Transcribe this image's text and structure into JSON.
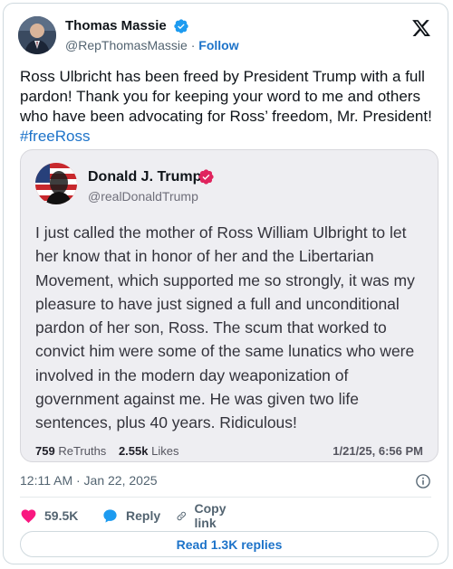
{
  "author": {
    "name": "Thomas Massie",
    "handle": "@RepThomasMassie",
    "separator": " · ",
    "follow_label": "Follow"
  },
  "tweet": {
    "text": "Ross Ulbricht has been freed by President Trump with a full pardon! Thank you for keeping your word to me and others who have been advocating for Ross’ freedom, Mr. President! ",
    "hashtag": "#freeRoss",
    "timestamp": "12:11 AM · Jan 22, 2025"
  },
  "quote": {
    "name": "Donald J. Trump",
    "handle": "@realDonaldTrump",
    "body": "I just called the mother of Ross William Ulbright to let her know that in honor of her and the Libertarian Movement, which supported me so strongly, it was my pleasure to have just signed a full and unconditional pardon of her son, Ross. The scum that worked to convict him were some of the same lunatics who were involved in the modern day weaponization of government against me. He was given two life sentences, plus 40 years. Ridiculous!",
    "retruths_count": "759",
    "retruths_label": "ReTruths",
    "likes_count": "2.55k",
    "likes_label": "Likes",
    "date": "1/21/25, 6:56 PM"
  },
  "actions": {
    "like_count": "59.5K",
    "reply_label": "Reply",
    "copy_link_label": "Copy link"
  },
  "replies_button_label": "Read 1.3K replies",
  "colors": {
    "link": "#1d73c9",
    "verified_blue": "#1d9bf0",
    "truth_verified_red": "#e0245e",
    "like_red": "#f91880",
    "reply_blue": "#1d9bf0"
  },
  "icons": [
    "verified-badge-icon",
    "x-logo-icon",
    "truth-verified-icon",
    "info-icon",
    "heart-icon",
    "reply-bubble-icon",
    "link-icon"
  ]
}
